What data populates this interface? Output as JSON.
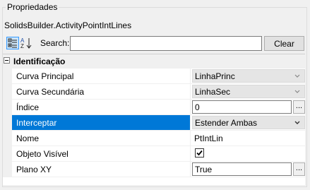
{
  "panel": {
    "title": "Propriedades",
    "object_name": "SolidsBuilder.ActivityPointIntLines"
  },
  "toolbar": {
    "categorized_icon": "categorized-view-icon",
    "alphabetical_icon": "alphabetical-sort-icon",
    "search_label": "Search:",
    "search_value": "",
    "clear_label": "Clear"
  },
  "grid": {
    "category": {
      "label": "Identificação"
    },
    "properties": [
      {
        "name": "Curva Principal",
        "value": "LinhaPrinc",
        "editor": "dropdown"
      },
      {
        "name": "Curva Secundária",
        "value": "LinhaSec",
        "editor": "dropdown"
      },
      {
        "name": "Índice",
        "value": "0",
        "editor": "textbox-ellipsis"
      },
      {
        "name": "Interceptar",
        "value": "Estender Ambas",
        "editor": "dropdown",
        "selected": true
      },
      {
        "name": "Nome",
        "value": "PtIntLin",
        "editor": "text"
      },
      {
        "name": "Objeto Visível",
        "value": true,
        "editor": "checkbox"
      },
      {
        "name": "Plano XY",
        "value": "True",
        "editor": "textbox-ellipsis"
      }
    ],
    "ellipsis_label": "...",
    "colors": {
      "selection": "#0078d7",
      "margin": "#f0f0f0"
    }
  }
}
